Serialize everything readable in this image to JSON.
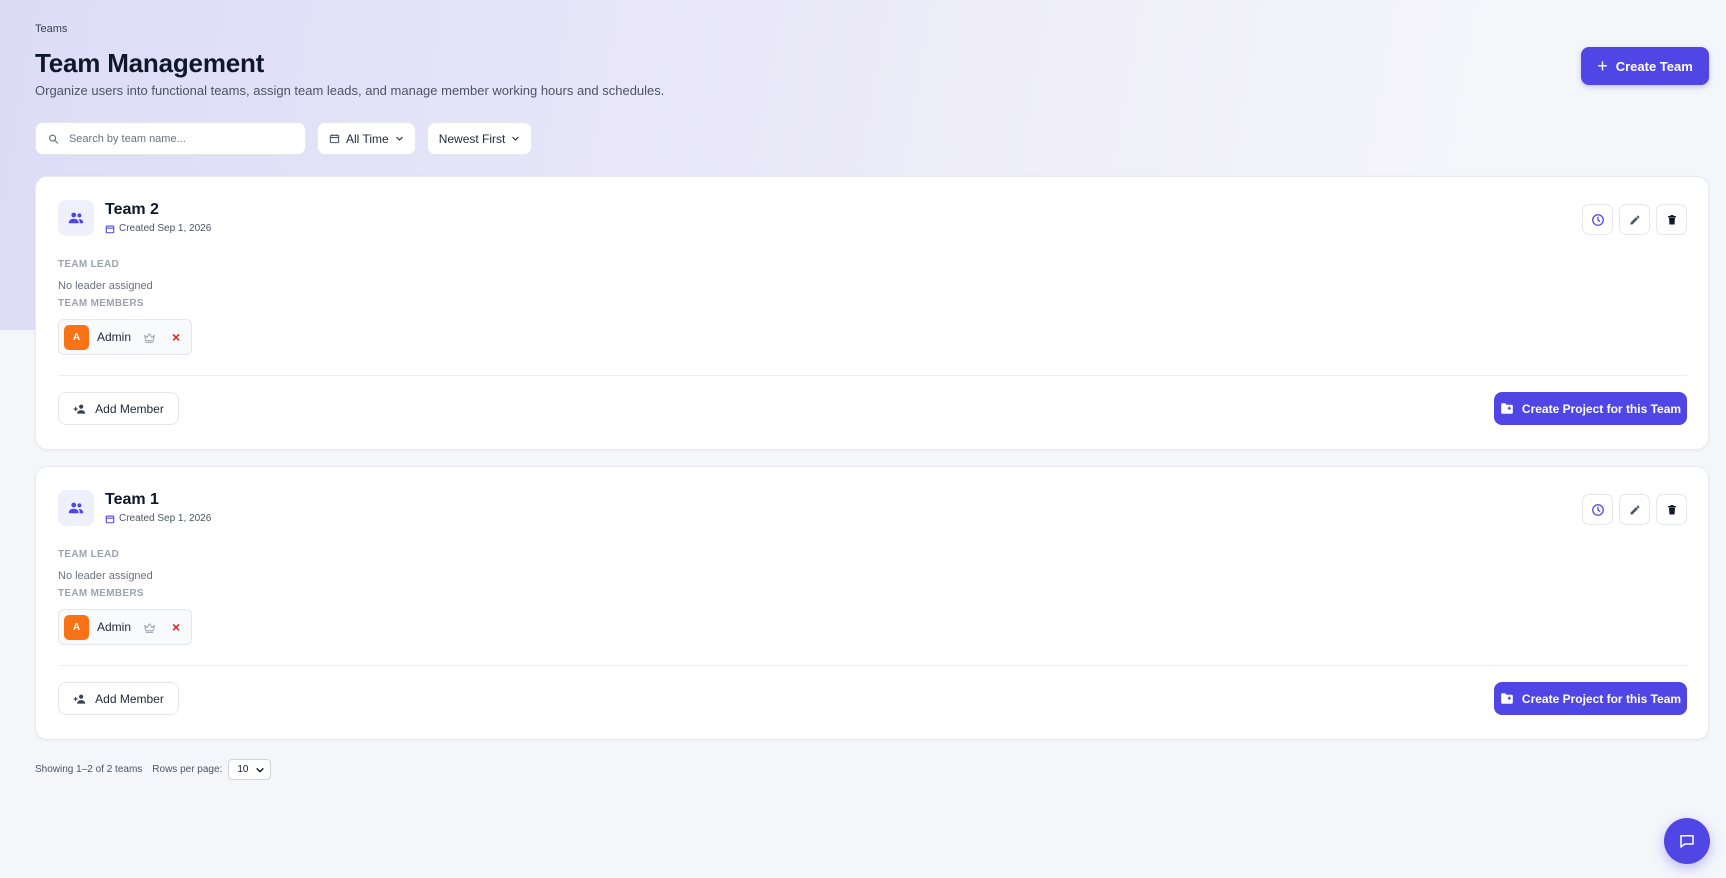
{
  "breadcrumb": "Teams",
  "header": {
    "title": "Team Management",
    "subtitle": "Organize users into functional teams, assign team leads, and manage member working hours and schedules.",
    "create_label": "Create Team"
  },
  "filters": {
    "search_placeholder": "Search by team name...",
    "search_value": "",
    "time_label": "All Time",
    "sort_label": "Newest First"
  },
  "labels": {
    "team_lead": "TEAM LEAD",
    "team_members": "TEAM MEMBERS",
    "no_leader": "No leader assigned",
    "add_member": "Add Member",
    "create_project": "Create Project for this Team"
  },
  "teams": [
    {
      "name": "Team 2",
      "created": "Created Sep 1, 2026",
      "members": [
        {
          "initial": "A",
          "name": "Admin",
          "color": "#f97316"
        }
      ]
    },
    {
      "name": "Team 1",
      "created": "Created Sep 1, 2026",
      "members": [
        {
          "initial": "A",
          "name": "Admin",
          "color": "#f97316"
        }
      ]
    }
  ],
  "pagination": {
    "summary": "Showing 1–2 of 2 teams",
    "rows_label": "Rows per page:",
    "rows_value": "10"
  },
  "colors": {
    "accent": "#4f46e5",
    "danger": "#dc2626",
    "member_avatar": "#f97316"
  },
  "icons": {
    "create": "plus-icon",
    "search": "search-icon",
    "calendar": "calendar-icon",
    "chevron": "chevron-down-icon",
    "team": "users-icon",
    "clock": "clock-icon",
    "edit": "pencil-icon",
    "delete": "trash-icon",
    "crown": "crown-icon",
    "remove": "close-icon",
    "add_user": "user-plus-icon",
    "folder": "folder-plus-icon",
    "chat": "chat-icon"
  }
}
